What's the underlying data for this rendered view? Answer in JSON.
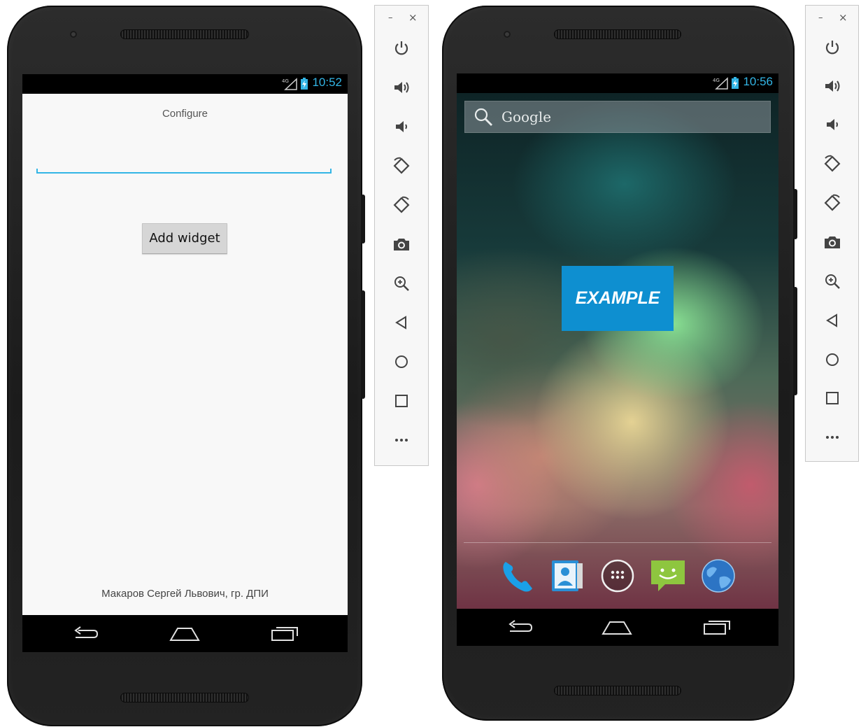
{
  "left_device": {
    "status_time": "10:52",
    "app_title": "Configure",
    "input_value": "",
    "add_button_label": "Add widget",
    "author_text": "Макаров Сергей Львович, гр. ДПИ"
  },
  "right_device": {
    "status_time": "10:56",
    "search_label": "Google",
    "widget_label": "EXAMPLE",
    "dock_apps": [
      "phone-icon",
      "contacts-icon",
      "app-drawer-icon",
      "messaging-icon",
      "browser-icon"
    ]
  },
  "emulator_toolbar": {
    "minimize_label": "–",
    "close_label": "×",
    "controls": [
      "power-icon",
      "volume-up-icon",
      "volume-down-icon",
      "rotate-left-icon",
      "rotate-right-icon",
      "camera-icon",
      "zoom-icon",
      "back-icon",
      "home-icon",
      "overview-icon",
      "more-icon"
    ]
  },
  "colors": {
    "accent": "#33b5e5",
    "widget_bg": "#0e8fd0",
    "phone_body": "#232323"
  }
}
